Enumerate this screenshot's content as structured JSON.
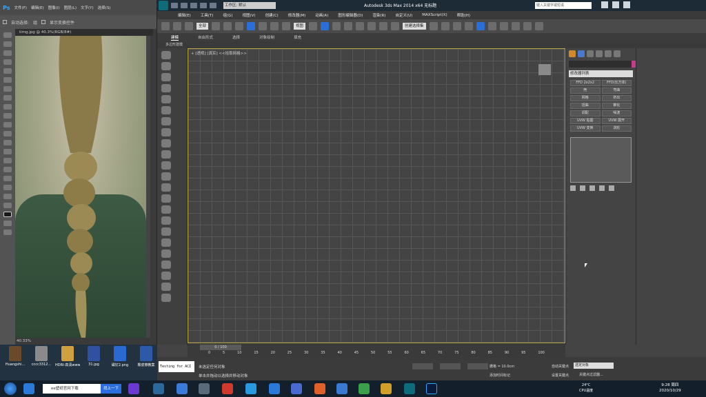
{
  "photoshop": {
    "logo": "Ps",
    "menu": [
      "文件(F)",
      "编辑(E)",
      "图像(I)",
      "图层(L)",
      "文字(Y)",
      "选择(S)"
    ],
    "options": {
      "auto_select": "自动选择:",
      "group": "组",
      "show_transform": "显示变换控件"
    },
    "doc_tab": "timg.jpg @ 40.3%(RGB/8#)",
    "zoom": "40.33%"
  },
  "desktop_icons": [
    {
      "label": "Huangshi...",
      "color": "#6a4a2a"
    },
    {
      "label": "cccc3312...",
      "color": "#8a8a8a"
    },
    {
      "label": "HDRI-高清www.shij...",
      "color": "#d0a040"
    },
    {
      "label": "31.jpg",
      "color": "#3050a0"
    },
    {
      "label": "磁钉2.png",
      "color": "#2a6ad0"
    },
    {
      "label": "橡皮擦教案",
      "color": "#2a5aa8"
    }
  ],
  "max": {
    "workspace": "工作区: 默认",
    "app_title": "Autodesk 3ds Max 2014 x64    无标题",
    "search_placeholder": "键入关键字或短语",
    "menu": [
      "编辑(E)",
      "工具(T)",
      "组(G)",
      "视图(V)",
      "创建(C)",
      "修改器(M)",
      "动画(A)",
      "图形编辑器(D)",
      "渲染(R)",
      "自定义(U)",
      "MAXScript(X)",
      "帮助(H)"
    ],
    "toolbar": {
      "filter": "全部",
      "view": "视图",
      "named_sel": "创建选择集"
    },
    "ribbon_tabs": [
      "建模",
      "自由形式",
      "选择",
      "对象绘制",
      "填充"
    ],
    "ribbon_sub": "多边形建模",
    "viewport_label": "+ [透视] [真实] <<拾取网格>>",
    "command_panel": {
      "dropdown": "修改器列表",
      "buttons": [
        "FFD 2x2x2",
        "FFD(长方体)",
        "壳",
        "弯曲",
        "网格",
        "挤出",
        "扭曲",
        "锥化",
        "调配",
        "噪波",
        "UVW 贴图",
        "UVW 展开",
        "UVW 变换",
        "涡轮"
      ]
    },
    "timeline": {
      "slider": "0 / 100",
      "ticks": [
        "0",
        "5",
        "10",
        "15",
        "20",
        "25",
        "30",
        "35",
        "40",
        "45",
        "50",
        "55",
        "60",
        "65",
        "70",
        "75",
        "80",
        "85",
        "90",
        "95",
        "100"
      ]
    },
    "status": {
      "maxscript": "Testing for ACI",
      "line1": "未选定任何对象",
      "line2": "单击并拖动以选择并移动对象",
      "grid": "栅格 = 10.0cm",
      "add_time": "添加时间标记",
      "autokey": "自动关键点",
      "setkey": "设置关键点",
      "selection": "选定对象",
      "keyfilter": "关键点过滤器..."
    }
  },
  "taskbar": {
    "search_text": "ee壁纸官网下载",
    "search_button": "找上一下",
    "cpu_temp": "24°C",
    "cpu_label": "CPU温度",
    "time": "9:28 周四",
    "date": "2020/10/29"
  }
}
